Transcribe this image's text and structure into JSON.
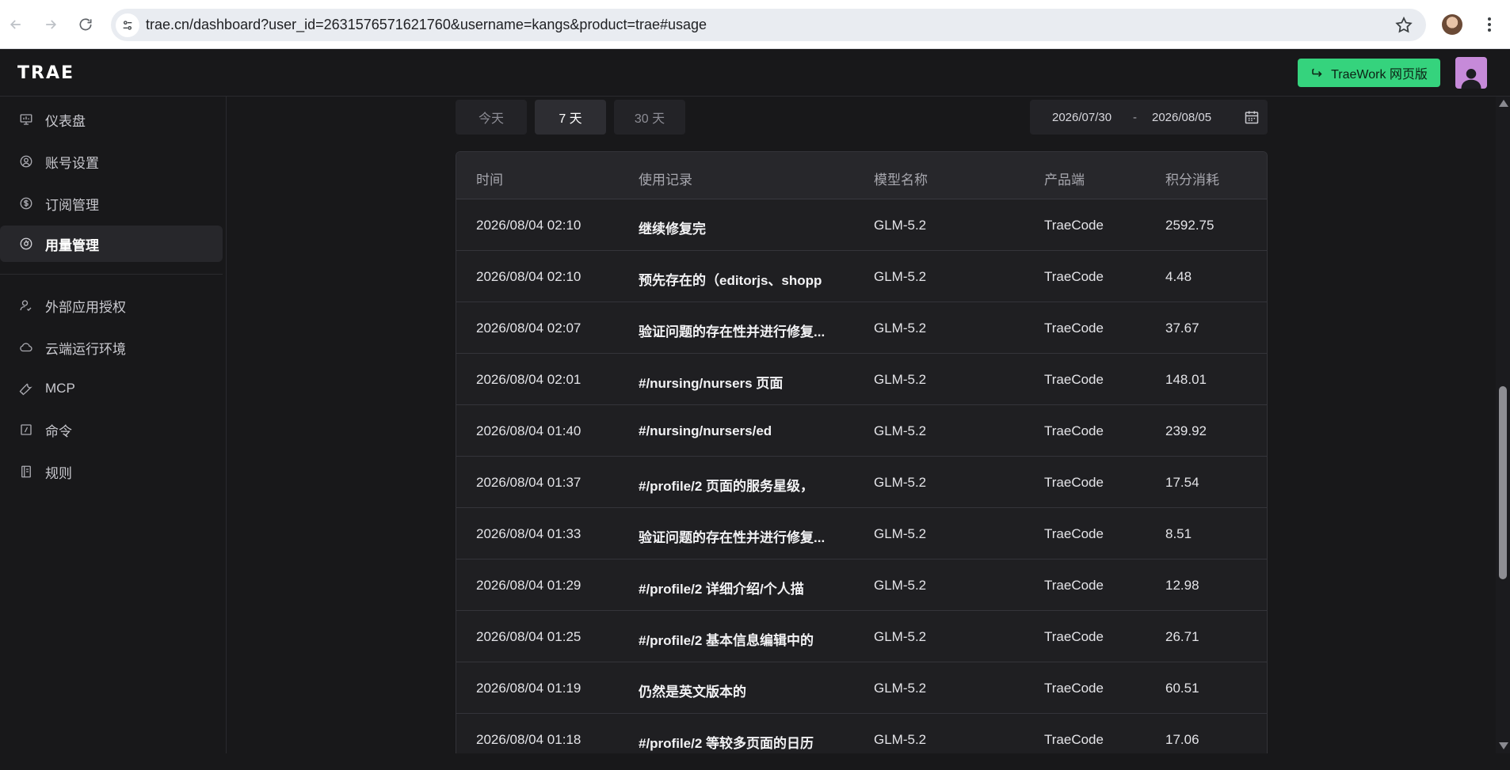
{
  "browser": {
    "url": "trae.cn/dashboard?user_id=2631576571621760&username=kangs&product=trae#usage"
  },
  "header": {
    "logo": "TRAE",
    "tw_button": "TraeWork 网页版"
  },
  "sidebar": {
    "items": [
      {
        "label": "仪表盘",
        "icon": "monitor-icon"
      },
      {
        "label": "账号设置",
        "icon": "user-circle-icon"
      },
      {
        "label": "订阅管理",
        "icon": "dollar-icon"
      },
      {
        "label": "用量管理",
        "icon": "gauge-icon"
      },
      {
        "label": "外部应用授权",
        "icon": "user-check-icon"
      },
      {
        "label": "云端运行环境",
        "icon": "cloud-icon"
      },
      {
        "label": "MCP",
        "icon": "wrench-icon"
      },
      {
        "label": "命令",
        "icon": "slash-box-icon"
      },
      {
        "label": "规则",
        "icon": "book-icon"
      }
    ],
    "active_index": 3
  },
  "filters": {
    "today": "今天",
    "seven_days": "7 天",
    "thirty_days": "30 天",
    "active": "seven_days",
    "date_start": "2026/07/30",
    "date_sep": "-",
    "date_end": "2026/08/05"
  },
  "table": {
    "headers": {
      "time": "时间",
      "record": "使用记录",
      "model": "模型名称",
      "product": "产品端",
      "points": "积分消耗"
    },
    "rows": [
      {
        "time": "2026/08/04 02:10",
        "record": "继续修复完",
        "model": "GLM-5.2",
        "product": "TraeCode",
        "points": "2592.75"
      },
      {
        "time": "2026/08/04 02:10",
        "record": "预先存在的（editorjs、shopp",
        "model": "GLM-5.2",
        "product": "TraeCode",
        "points": "4.48"
      },
      {
        "time": "2026/08/04 02:07",
        "record": "验证问题的存在性并进行修复...",
        "model": "GLM-5.2",
        "product": "TraeCode",
        "points": "37.67"
      },
      {
        "time": "2026/08/04 02:01",
        "record": "#/nursing/nursers 页面",
        "model": "GLM-5.2",
        "product": "TraeCode",
        "points": "148.01"
      },
      {
        "time": "2026/08/04 01:40",
        "record": "#/nursing/nursers/ed",
        "model": "GLM-5.2",
        "product": "TraeCode",
        "points": "239.92"
      },
      {
        "time": "2026/08/04 01:37",
        "record": "#/profile/2 页面的服务星级，",
        "model": "GLM-5.2",
        "product": "TraeCode",
        "points": "17.54"
      },
      {
        "time": "2026/08/04 01:33",
        "record": "验证问题的存在性并进行修复...",
        "model": "GLM-5.2",
        "product": "TraeCode",
        "points": "8.51"
      },
      {
        "time": "2026/08/04 01:29",
        "record": "#/profile/2 详细介绍/个人描",
        "model": "GLM-5.2",
        "product": "TraeCode",
        "points": "12.98"
      },
      {
        "time": "2026/08/04 01:25",
        "record": "#/profile/2 基本信息编辑中的",
        "model": "GLM-5.2",
        "product": "TraeCode",
        "points": "26.71"
      },
      {
        "time": "2026/08/04 01:19",
        "record": "仍然是英文版本的",
        "model": "GLM-5.2",
        "product": "TraeCode",
        "points": "60.51"
      },
      {
        "time": "2026/08/04 01:18",
        "record": "#/profile/2 等较多页面的日历",
        "model": "GLM-5.2",
        "product": "TraeCode",
        "points": "17.06"
      }
    ]
  },
  "colors": {
    "accent_green": "#35d37d",
    "avatar_purple": "#c68ad9",
    "background": "#18181a"
  }
}
